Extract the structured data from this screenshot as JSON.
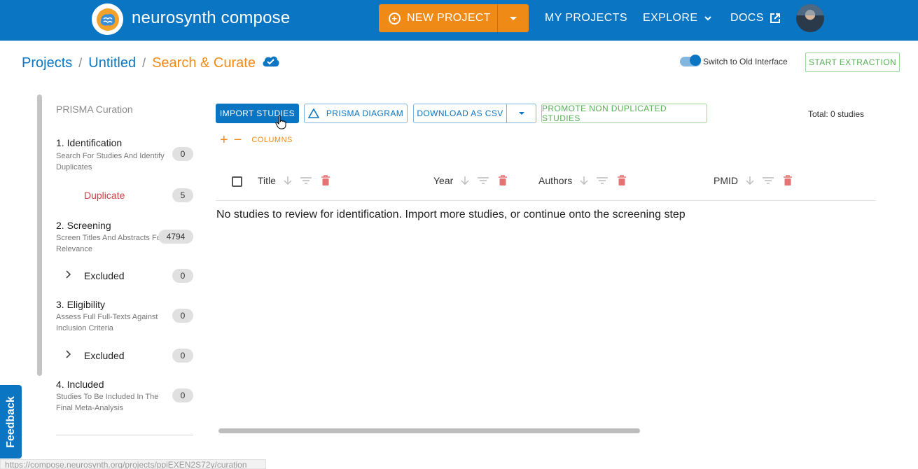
{
  "app": {
    "brand": "neurosynth compose",
    "logo_icon": "brain-icon"
  },
  "nav": {
    "new_project": "NEW PROJECT",
    "my_projects": "MY PROJECTS",
    "explore": "EXPLORE",
    "docs": "DOCS"
  },
  "breadcrumb": {
    "projects": "Projects",
    "project_name": "Untitled",
    "current": "Search & Curate"
  },
  "header_controls": {
    "toggle_label": "Switch to Old Interface",
    "toggle_on": true,
    "start_extraction": "START EXTRACTION"
  },
  "sidebar": {
    "title": "PRISMA Curation",
    "steps": [
      {
        "title": "1. Identification",
        "description": "Search For Studies And Identify Duplicates",
        "count": "0",
        "sub_label": "Duplicate",
        "sub_count": "5"
      },
      {
        "title": "2. Screening",
        "description": "Screen Titles And Abstracts For Relevance",
        "count": "4794",
        "sub_label": "Excluded",
        "sub_count": "0"
      },
      {
        "title": "3. Eligibility",
        "description": "Assess Full Full-Texts Against Inclusion Criteria",
        "count": "0",
        "sub_label": "Excluded",
        "sub_count": "0"
      },
      {
        "title": "4. Included",
        "description": "Studies To Be Included In The Final Meta-Analysis",
        "count": "0"
      }
    ]
  },
  "toolbar": {
    "import_studies": "IMPORT STUDIES",
    "prisma_diagram": "PRISMA DIAGRAM",
    "download_csv": "DOWNLOAD AS CSV",
    "promote": "PROMOTE NON DUPLICATED STUDIES",
    "total": "Total: 0 studies",
    "columns": "COLUMNS"
  },
  "table": {
    "columns": [
      "Title",
      "Year",
      "Authors",
      "PMID"
    ],
    "empty_message": "No studies to review for identification. Import more studies, or continue onto the screening step"
  },
  "feedback": "Feedback",
  "status_url": "https://compose.neurosynth.org/projects/ppiEXEN2S72y/curation",
  "colors": {
    "primary": "#0a75c2",
    "accent": "#ef8a17",
    "success": "#55b055",
    "danger": "#e57373"
  }
}
